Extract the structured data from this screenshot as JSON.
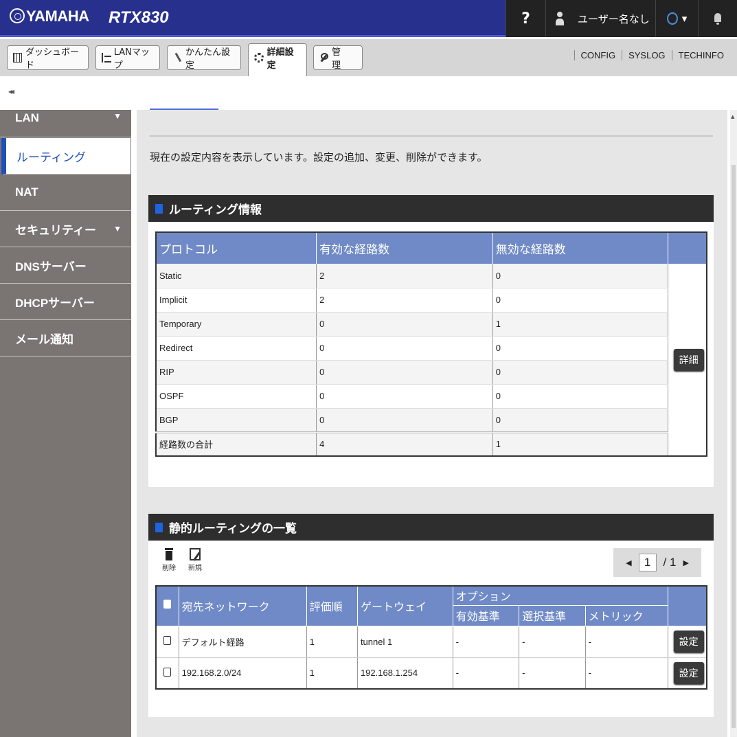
{
  "header": {
    "brand": "YAMAHA",
    "model": "RTX830",
    "help": "?",
    "user": "ユーザー名なし",
    "status_caret": "▾"
  },
  "tabs": [
    {
      "label": "ダッシュボード",
      "icon": "dashboard-icon"
    },
    {
      "label": "LANマップ",
      "icon": "lan-map-icon"
    },
    {
      "label": "かんたん設定",
      "icon": "wand-icon"
    },
    {
      "label": "詳細設定",
      "icon": "gear-icon",
      "active": true
    },
    {
      "label": "管　理",
      "icon": "wrench-icon"
    }
  ],
  "toplinks": [
    "CONFIG",
    "SYSLOG",
    "TECHINFO"
  ],
  "collapse": "◂◂",
  "sidebar": {
    "items": [
      {
        "label": "LAN",
        "caret": "▼"
      },
      {
        "label": "ルーティング"
      },
      {
        "label": "NAT"
      },
      {
        "label": "セキュリティー",
        "caret": "▼"
      },
      {
        "label": "DNSサーバー"
      },
      {
        "label": "DHCPサーバー"
      },
      {
        "label": "メール通知"
      }
    ]
  },
  "main": {
    "intro": "現在の設定内容を表示しています。設定の追加、変更、削除ができます。",
    "routing_info": {
      "title": "ルーティング情報",
      "headers": [
        "プロトコル",
        "有効な経路数",
        "無効な経路数"
      ],
      "rows": [
        [
          "Static",
          "2",
          "0"
        ],
        [
          "Implicit",
          "2",
          "0"
        ],
        [
          "Temporary",
          "0",
          "1"
        ],
        [
          "Redirect",
          "0",
          "0"
        ],
        [
          "RIP",
          "0",
          "0"
        ],
        [
          "OSPF",
          "0",
          "0"
        ],
        [
          "BGP",
          "0",
          "0"
        ]
      ],
      "total": [
        "経路数の合計",
        "4",
        "1"
      ],
      "detail_button": "詳細"
    },
    "static_routes": {
      "title": "静的ルーティングの一覧",
      "delete_label": "削除",
      "new_label": "新規",
      "pager": {
        "current": "1",
        "total": "/ 1",
        "prev": "◀",
        "next": "▶"
      },
      "headers": {
        "destination": "宛先ネットワーク",
        "priority": "評価順",
        "gateway": "ゲートウェイ",
        "option": "オプション",
        "valid": "有効基準",
        "select": "選択基準",
        "metric": "メトリック"
      },
      "rows": [
        {
          "destination": "デフォルト経路",
          "priority": "1",
          "gateway": "tunnel 1",
          "valid": "-",
          "select": "-",
          "metric": "-",
          "button": "設定"
        },
        {
          "destination": "192.168.2.0/24",
          "priority": "1",
          "gateway": "192.168.1.254",
          "valid": "-",
          "select": "-",
          "metric": "-",
          "button": "設定"
        }
      ]
    }
  },
  "colors": {
    "header_bg": "#28308e",
    "accent": "#1f4fb8",
    "table_header": "#6f8ac6",
    "sidebar_bg": "#7a7472"
  }
}
